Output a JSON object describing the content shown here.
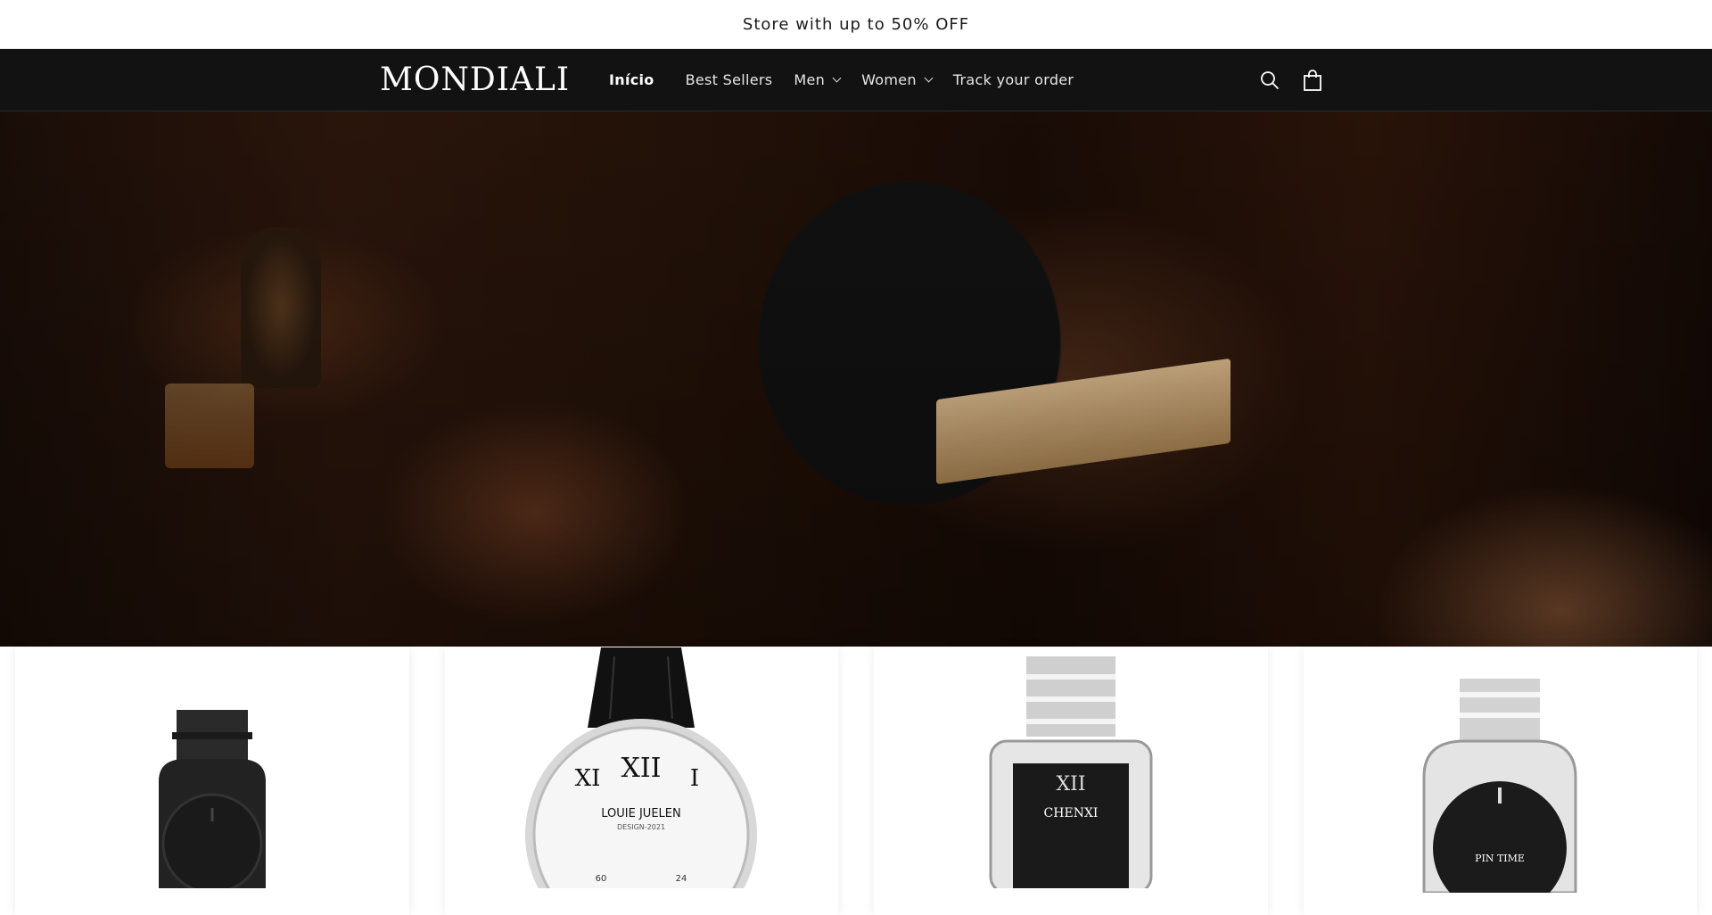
{
  "announcement": {
    "text": "Store with up to 50% OFF"
  },
  "header": {
    "logo_text": "MONDIALI",
    "nav": [
      {
        "label": "Início",
        "active": true,
        "has_dropdown": false
      },
      {
        "label": "Best Sellers",
        "active": false,
        "has_dropdown": false
      },
      {
        "label": "Men",
        "active": false,
        "has_dropdown": true
      },
      {
        "label": "Women",
        "active": false,
        "has_dropdown": true
      },
      {
        "label": "Track your order",
        "active": false,
        "has_dropdown": false
      }
    ],
    "icons": [
      "search-icon",
      "cart-icon"
    ]
  },
  "hero": {
    "image": "man-reading-book-in-leather-armchair"
  },
  "products": [
    {
      "image": "black-steel-watch"
    },
    {
      "image": "silver-leather-chronograph-watch",
      "dial_brand": "LOUIE JUELEN"
    },
    {
      "image": "silver-rectangular-watch",
      "dial_brand": "CHENXI"
    },
    {
      "image": "silver-steel-watch",
      "dial_brand": "PIN TIME"
    }
  ],
  "colors": {
    "header_bg": "#121212",
    "announcement_bg": "#ffffff",
    "text_light": "#ffffff"
  }
}
